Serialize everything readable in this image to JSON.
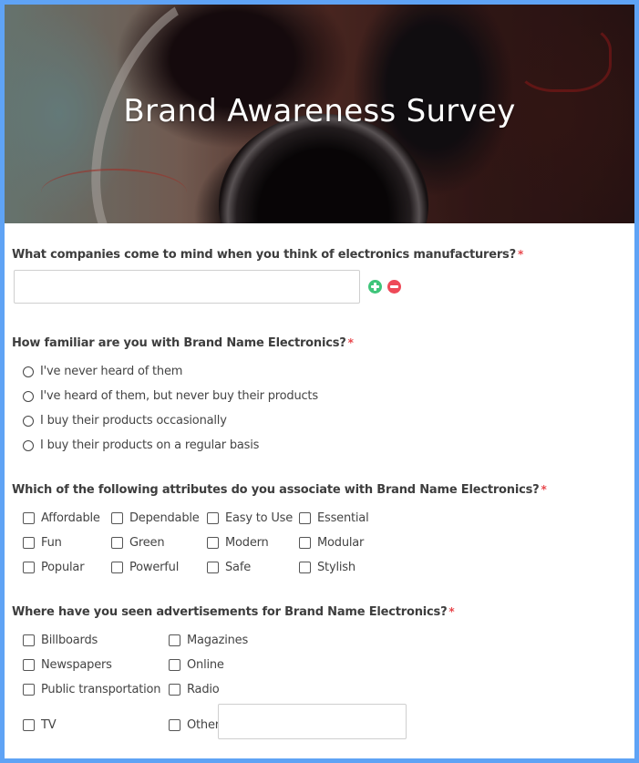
{
  "header": {
    "title": "Brand Awareness Survey",
    "image_description": "headphones"
  },
  "colors": {
    "frame": "#5fa3f5",
    "required": "#e8474c",
    "add": "#3fc57a",
    "remove": "#ee4a58"
  },
  "required_marker": "*",
  "questions": [
    {
      "label": "What companies come to mind when you think of electronics manufacturers?",
      "type": "text",
      "value": "",
      "placeholder": "",
      "buttons": {
        "add": "add-icon",
        "remove": "remove-icon"
      }
    },
    {
      "label": "How familiar are you with Brand Name Electronics?",
      "type": "radio",
      "options": [
        "I've never heard of them",
        "I've heard of them, but never buy their products",
        "I buy their products occasionally",
        "I buy their products on a regular basis"
      ]
    },
    {
      "label": "Which of the following attributes do you associate with Brand Name Electronics?",
      "type": "checkbox",
      "options": [
        "Affordable",
        "Dependable",
        "Easy to Use",
        "Essential",
        "Fun",
        "Green",
        "Modern",
        "Modular",
        "Popular",
        "Powerful",
        "Safe",
        "Stylish"
      ]
    },
    {
      "label": "Where have you seen advertisements for Brand Name Electronics?",
      "type": "checkbox",
      "options": [
        "Billboards",
        "Magazines",
        "Newspapers",
        "Online",
        "Public transportation",
        "Radio",
        "TV",
        "Other"
      ],
      "other_value": ""
    }
  ]
}
